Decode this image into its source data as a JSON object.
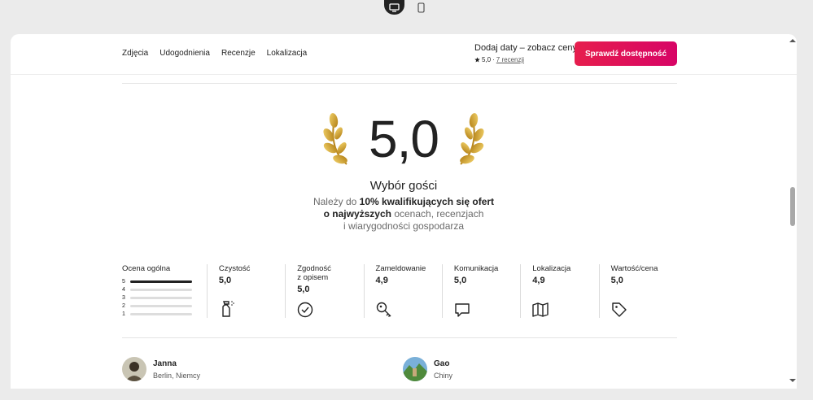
{
  "device_switch": {
    "desktop_icon": "monitor-icon",
    "mobile_icon": "phone-icon"
  },
  "subnav": {
    "links": [
      "Zdjęcia",
      "Udogodnienia",
      "Recenzje",
      "Lokalizacja"
    ],
    "price_title": "Dodaj daty – zobacz ceny",
    "rating": "5,0",
    "separator": "·",
    "reviews_link": "7 recenzji",
    "cta_label": "Sprawdź dostępność"
  },
  "hero": {
    "score": "5,0",
    "title": "Wybór gości",
    "desc_1_a": "Należy do ",
    "desc_1_b": "10% kwalifikujących się ofert",
    "desc_2_a": "o najwyższych",
    "desc_2_b": " ocenach, recenzjach",
    "desc_3": "i wiarygodności gospodarza"
  },
  "overall": {
    "label": "Ocena ogólna",
    "rows": [
      {
        "stars": "5",
        "fraction": 1.0
      },
      {
        "stars": "4",
        "fraction": 0
      },
      {
        "stars": "3",
        "fraction": 0
      },
      {
        "stars": "2",
        "fraction": 0
      },
      {
        "stars": "1",
        "fraction": 0
      }
    ]
  },
  "categories": [
    {
      "label": "Czystość",
      "value": "5,0",
      "icon": "spray-bottle-icon"
    },
    {
      "label": "Zgodność z opisem",
      "value": "5,0",
      "icon": "check-circle-icon"
    },
    {
      "label": "Zameldowanie",
      "value": "4,9",
      "icon": "key-icon"
    },
    {
      "label": "Komunikacja",
      "value": "5,0",
      "icon": "chat-bubble-icon"
    },
    {
      "label": "Lokalizacja",
      "value": "4,9",
      "icon": "map-icon"
    },
    {
      "label": "Wartość/cena",
      "value": "5,0",
      "icon": "tag-icon"
    }
  ],
  "reviews": [
    {
      "name": "Janna",
      "location": "Berlin, Niemcy"
    },
    {
      "name": "Gao",
      "location": "Chiny"
    }
  ],
  "colors": {
    "accent": "#e61e4d",
    "text": "#222222",
    "muted": "#6a6a6a",
    "gold": "#d4a52a"
  }
}
